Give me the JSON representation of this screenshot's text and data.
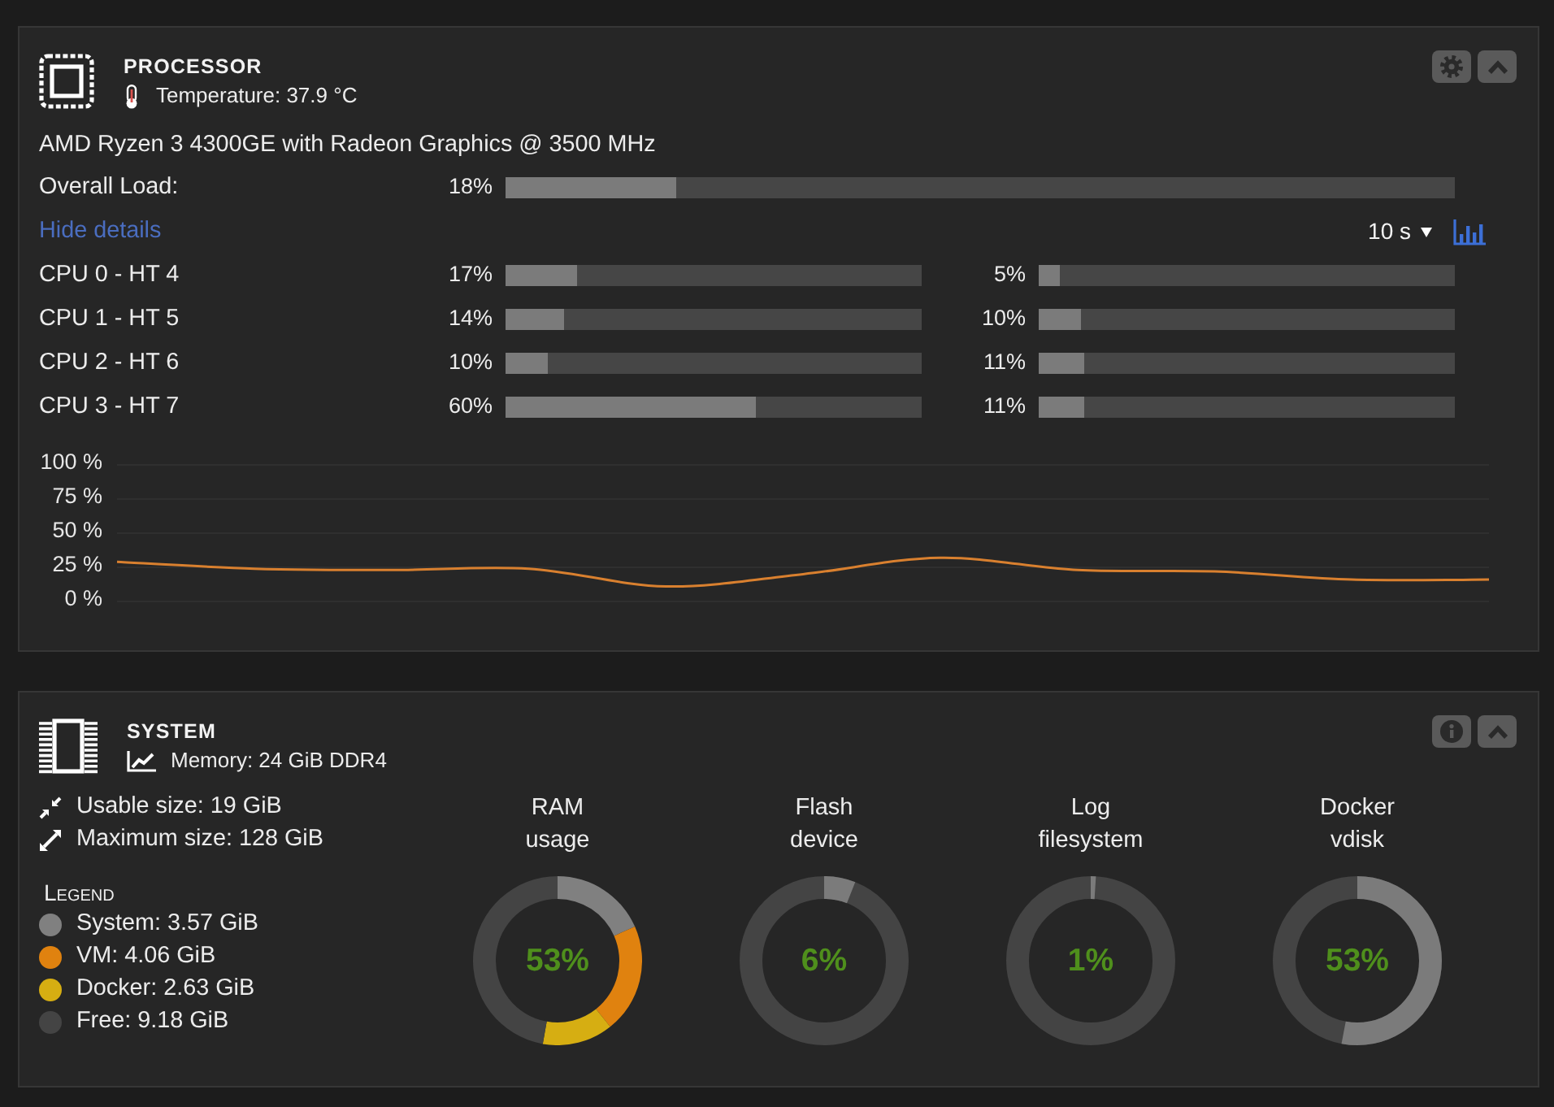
{
  "processor": {
    "title": "PROCESSOR",
    "temperature": "Temperature: 37.9 °C",
    "model": "AMD Ryzen 3 4300GE with Radeon Graphics @ 3500 MHz",
    "overall_load": {
      "label": "Overall Load:",
      "reading": "18%",
      "level": 0.18
    },
    "details_link": "Hide details",
    "interval": "10 s",
    "cores": [
      {
        "label": "CPU 0 - HT 4",
        "threads": [
          {
            "reading": "17%",
            "level": 0.17
          },
          {
            "reading": "5%",
            "level": 0.05
          }
        ]
      },
      {
        "label": "CPU 1 - HT 5",
        "threads": [
          {
            "reading": "14%",
            "level": 0.14
          },
          {
            "reading": "10%",
            "level": 0.1
          }
        ]
      },
      {
        "label": "CPU 2 - HT 6",
        "threads": [
          {
            "reading": "10%",
            "level": 0.1
          },
          {
            "reading": "11%",
            "level": 0.11
          }
        ]
      },
      {
        "label": "CPU 3 - HT 7",
        "threads": [
          {
            "reading": "60%",
            "level": 0.6
          },
          {
            "reading": "11%",
            "level": 0.11
          }
        ]
      }
    ],
    "chart_data": {
      "type": "line",
      "grid": true,
      "ylim": [
        0,
        100
      ],
      "yticks": [
        {
          "value": 100,
          "label": "100 %"
        },
        {
          "value": 75,
          "label": "75 %"
        },
        {
          "value": 50,
          "label": "50 %"
        },
        {
          "value": 25,
          "label": "25 %"
        },
        {
          "value": 0,
          "label": "0 %"
        }
      ],
      "series": [
        {
          "color": "#d9802f",
          "values": [
            29,
            24,
            23,
            24,
            11,
            20,
            32,
            23,
            22,
            16,
            16
          ]
        }
      ]
    }
  },
  "system": {
    "title": "SYSTEM",
    "memory": "Memory: 24 GiB DDR4",
    "usable": "Usable size: 19 GiB",
    "maximum": "Maximum size: 128 GiB",
    "legend_title": "Legend",
    "legend": [
      {
        "label": "System: 3.57 GiB",
        "color": "#808080"
      },
      {
        "label": "VM: 4.06 GiB",
        "color": "#e0820f"
      },
      {
        "label": "Docker: 2.63 GiB",
        "color": "#d6ae12"
      },
      {
        "label": "Free: 9.18 GiB",
        "color": "#444444"
      }
    ],
    "gauges": [
      {
        "kind": "chart",
        "title": "RAM usage",
        "reading": "53%",
        "chart_data": {
          "type": "donut",
          "series": [
            {
              "values": [
                18.4,
                20.9,
                13.5,
                47.2
              ]
            }
          ]
        }
      },
      {
        "kind": "single",
        "title": "Flash device",
        "reading": "6%",
        "level": 0.06
      },
      {
        "kind": "single",
        "title": "Log filesystem",
        "reading": "1%",
        "level": 0.01
      },
      {
        "kind": "single",
        "title": "Docker vdisk",
        "reading": "53%",
        "level": 0.53
      }
    ]
  }
}
